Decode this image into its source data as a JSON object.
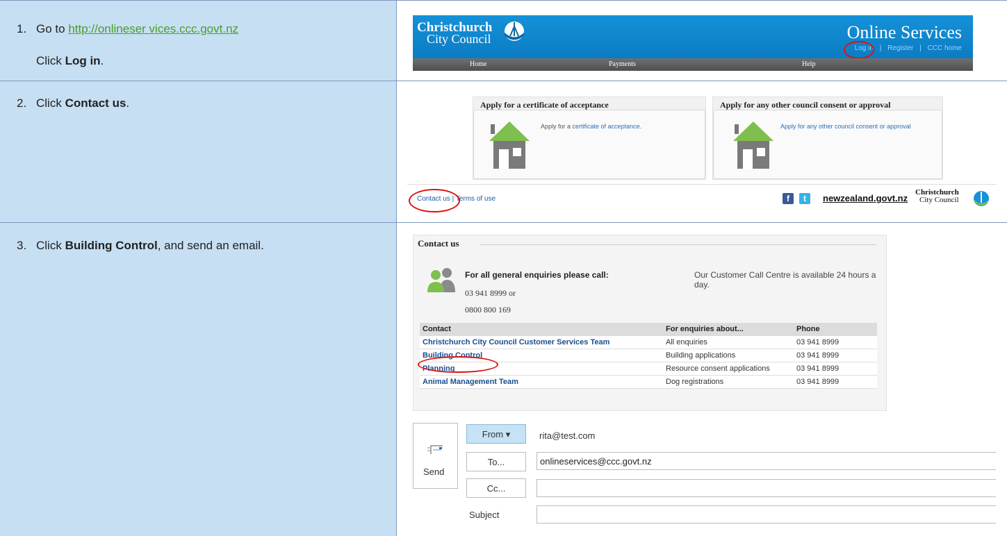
{
  "steps": [
    {
      "num": "1.",
      "text_prefix": "Go to ",
      "link": "http://onlineser vices.ccc.govt.nz",
      "line2_prefix": "Click ",
      "line2_bold": "Log in",
      "line2_suffix": "."
    },
    {
      "num": "2.",
      "text_prefix": "Click ",
      "bold": "Contact us",
      "suffix": "."
    },
    {
      "num": "3.",
      "text_prefix": "Click ",
      "bold": "Building Control",
      "suffix": ", and send an email."
    }
  ],
  "header": {
    "logo_line1": "Christchurch",
    "logo_line2": "City Council",
    "title": "Online Services",
    "links": [
      "Log in",
      "Register",
      "CCC home"
    ],
    "nav": [
      "Home",
      "Payments",
      "Help"
    ]
  },
  "apply": [
    {
      "title": "Apply for a certificate of acceptance",
      "text_prefix": "Apply for a ",
      "link": "certificate of acceptance",
      "text_suffix": "."
    },
    {
      "title": "Apply for any other council consent or approval",
      "link": "Apply for any other council consent or approval"
    }
  ],
  "footer": {
    "contact_us": "Contact us",
    "separator": "|",
    "terms": "Terms of use",
    "facebook": "f",
    "twitter": "t",
    "nzgovt": "newzealand.govt.nz",
    "logo_line1": "Christchurch",
    "logo_line2": "City Council"
  },
  "contact": {
    "title": "Contact us",
    "general_label": "For all general enquiries please call:",
    "phone1": "03 941 8999 or",
    "phone2": "0800 800 169",
    "call_centre": "Our Customer Call Centre is available 24 hours a day.",
    "table_headers": [
      "Contact",
      "For enquiries about...",
      "Phone"
    ],
    "rows": [
      {
        "contact": "Christchurch City Council Customer Services Team",
        "about": "All enquiries",
        "phone": "03 941 8999"
      },
      {
        "contact": "Building Control",
        "about": "Building applications",
        "phone": "03 941 8999"
      },
      {
        "contact": "Planning",
        "about": "Resource consent applications",
        "phone": "03 941 8999"
      },
      {
        "contact": "Animal Management Team",
        "about": "Dog registrations",
        "phone": "03 941 8999"
      }
    ]
  },
  "email": {
    "send_label": "Send",
    "from_label": "From",
    "from_value": "rita@test.com",
    "to_label": "To...",
    "to_value": "onlineservices@ccc.govt.nz",
    "cc_label": "Cc...",
    "cc_value": "",
    "subject_label": "Subject",
    "subject_value": ""
  },
  "colors": {
    "step_bg": "#c7dff3",
    "link_green": "#4a9e2a",
    "ccc_blue": "#0b7cc3",
    "highlight_red": "#dd1111",
    "house_green": "#7fbf4d"
  }
}
